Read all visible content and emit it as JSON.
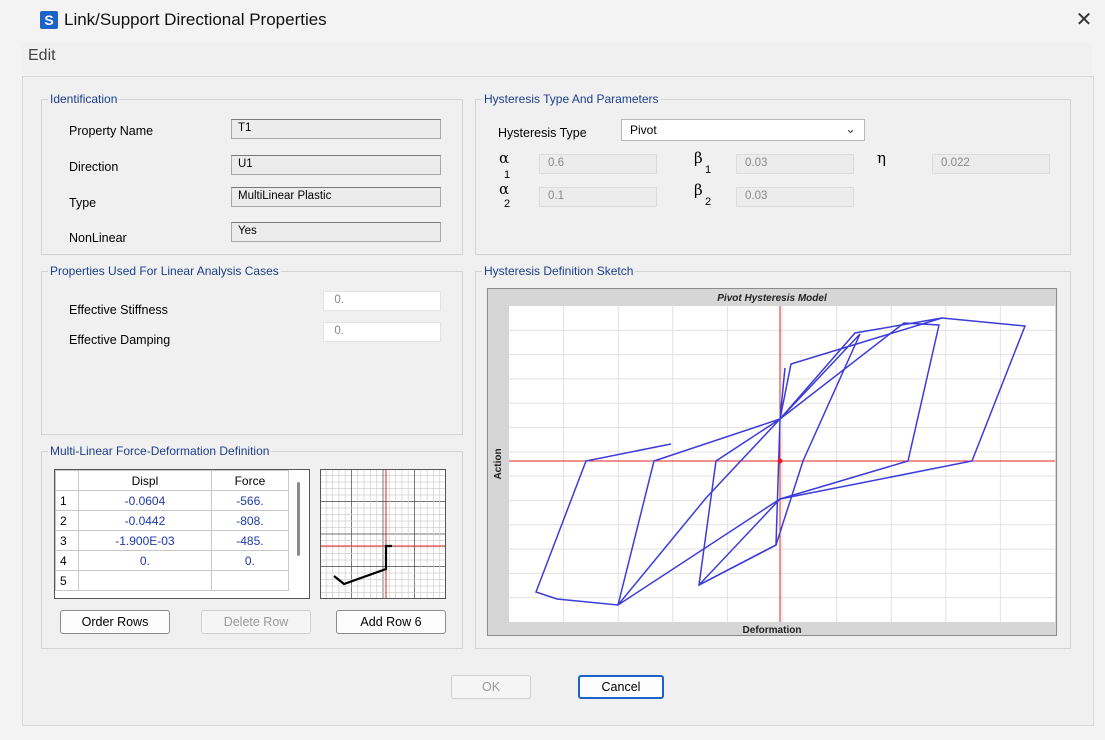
{
  "window": {
    "app_icon_letter": "S",
    "title": "Link/Support Directional Properties",
    "close_glyph": "✕"
  },
  "menu": {
    "edit": "Edit"
  },
  "identification": {
    "title": "Identification",
    "property_name_label": "Property Name",
    "property_name": "T1",
    "direction_label": "Direction",
    "direction": "U1",
    "type_label": "Type",
    "type": "MultiLinear Plastic",
    "nonlinear_label": "NonLinear",
    "nonlinear": "Yes"
  },
  "linear": {
    "title": "Properties Used For Linear Analysis Cases",
    "stiffness_label": "Effective Stiffness",
    "stiffness": "0.",
    "damping_label": "Effective Damping",
    "damping": "0."
  },
  "hysteresis": {
    "title": "Hysteresis Type And Parameters",
    "type_label": "Hysteresis Type",
    "type": "Pivot",
    "alpha": "α",
    "beta": "β",
    "eta": "η",
    "sub1": "1",
    "sub2": "2",
    "alpha1": "0.6",
    "beta1": "0.03",
    "eta_value": "0.022",
    "alpha2": "0.1",
    "beta2": "0.03"
  },
  "sketch": {
    "title": "Hysteresis Definition Sketch",
    "chart_title": "Pivot Hysteresis Model",
    "xlabel": "Deformation",
    "ylabel": "Action"
  },
  "multilinear": {
    "title": "Multi-Linear Force-Deformation Definition",
    "headers": {
      "displ": "Displ",
      "force": "Force"
    },
    "rows": [
      {
        "n": "1",
        "displ": "-0.0604",
        "force": "-566."
      },
      {
        "n": "2",
        "displ": "-0.0442",
        "force": "-808."
      },
      {
        "n": "3",
        "displ": "-1.900E-03",
        "force": "-485."
      },
      {
        "n": "4",
        "displ": "0.",
        "force": "0."
      }
    ],
    "partial_row_n": "5",
    "order_rows": "Order Rows",
    "delete_row": "Delete Row",
    "add_row": "Add Row 6"
  },
  "buttons": {
    "ok": "OK",
    "cancel": "Cancel"
  },
  "colors": {
    "curve": "#3c3cd8",
    "axis": "#e02020",
    "frame": "#8c8c8c",
    "accent": "#1b63c6"
  }
}
